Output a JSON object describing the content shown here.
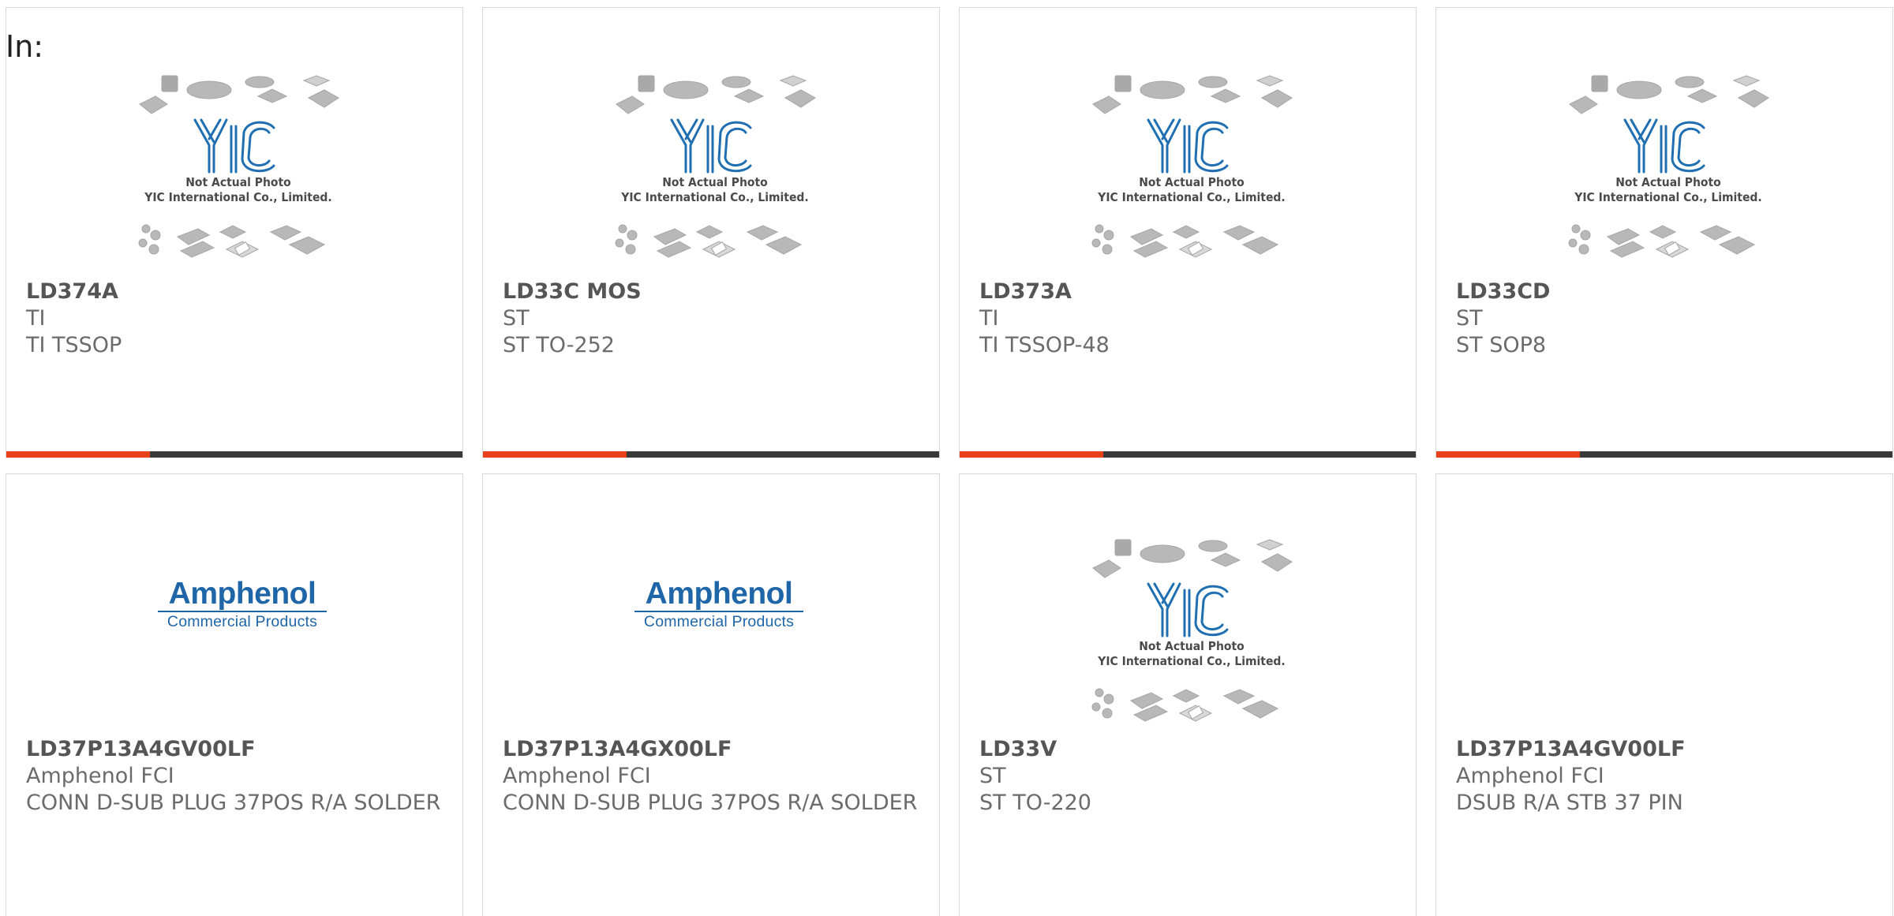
{
  "header": {
    "label": "In:"
  },
  "theme": {
    "accent": "#e8411b",
    "bar": "#3a3a3a",
    "brand_blue": "#1f66a8",
    "text": "#6b6b6b"
  },
  "placeholder": {
    "line1": "Not Actual Photo",
    "line2": "YIC International Co., Limited."
  },
  "amphenol_logo": {
    "name": "Amphenol",
    "sub": "Commercial Products"
  },
  "products": [
    {
      "part": "LD374A",
      "brand": "TI",
      "desc": "TI TSSOP",
      "image": "yic-placeholder"
    },
    {
      "part": "LD33C MOS",
      "brand": "ST",
      "desc": "ST TO-252",
      "image": "yic-placeholder"
    },
    {
      "part": "LD373A",
      "brand": "TI",
      "desc": "TI TSSOP-48",
      "image": "yic-placeholder"
    },
    {
      "part": "LD33CD",
      "brand": "ST",
      "desc": "ST SOP8",
      "image": "yic-placeholder"
    },
    {
      "part": "LD37P13A4GV00LF",
      "brand": "Amphenol FCI",
      "desc": "CONN D-SUB PLUG 37POS R/A SOLDER",
      "image": "amphenol-logo"
    },
    {
      "part": "LD37P13A4GX00LF",
      "brand": "Amphenol FCI",
      "desc": "CONN D-SUB PLUG 37POS R/A SOLDER",
      "image": "amphenol-logo"
    },
    {
      "part": "LD33V",
      "brand": "ST",
      "desc": "ST TO-220",
      "image": "yic-placeholder"
    },
    {
      "part": "LD37P13A4GV00LF",
      "brand": "Amphenol FCI",
      "desc": "DSUB R/A STB 37 PIN",
      "image": "amphenol-logo-hidden"
    }
  ]
}
